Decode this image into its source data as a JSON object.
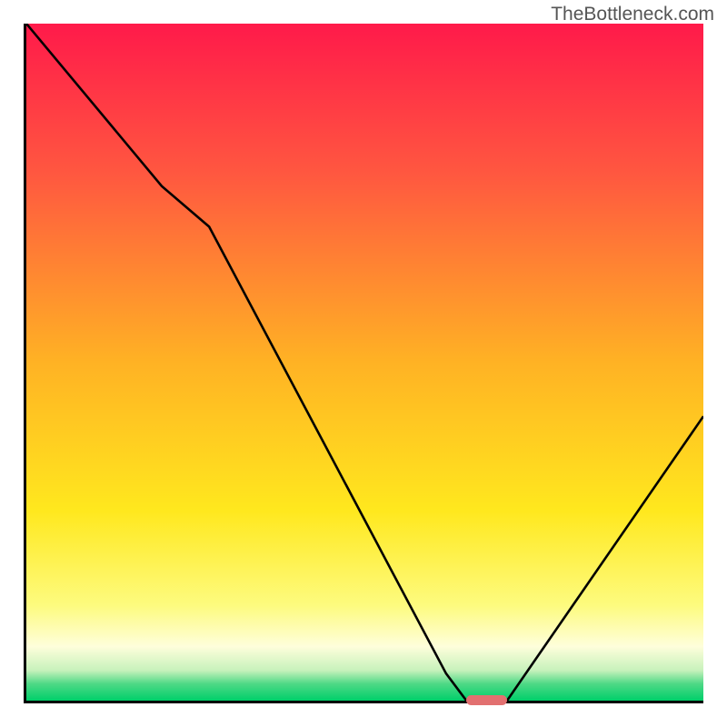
{
  "watermark": "TheBottleneck.com",
  "chart_data": {
    "type": "line",
    "title": "",
    "xlabel": "",
    "ylabel": "",
    "x": [
      0,
      20,
      27,
      62,
      65,
      71,
      100
    ],
    "values": [
      100,
      76,
      70,
      4,
      0,
      0,
      42
    ],
    "xlim": [
      0,
      100
    ],
    "ylim": [
      0,
      100
    ],
    "marker": {
      "x_center": 68,
      "x_width": 6,
      "y": 0,
      "color": "#e27070"
    },
    "gradient_stops": [
      {
        "offset": 0,
        "color": "#ff1a4a"
      },
      {
        "offset": 22,
        "color": "#ff5740"
      },
      {
        "offset": 50,
        "color": "#ffb224"
      },
      {
        "offset": 72,
        "color": "#ffe81e"
      },
      {
        "offset": 86,
        "color": "#fdfb7f"
      },
      {
        "offset": 92,
        "color": "#fefedb"
      },
      {
        "offset": 95.5,
        "color": "#c8f2bc"
      },
      {
        "offset": 97.5,
        "color": "#4fd986"
      },
      {
        "offset": 100,
        "color": "#00cf6a"
      }
    ]
  }
}
